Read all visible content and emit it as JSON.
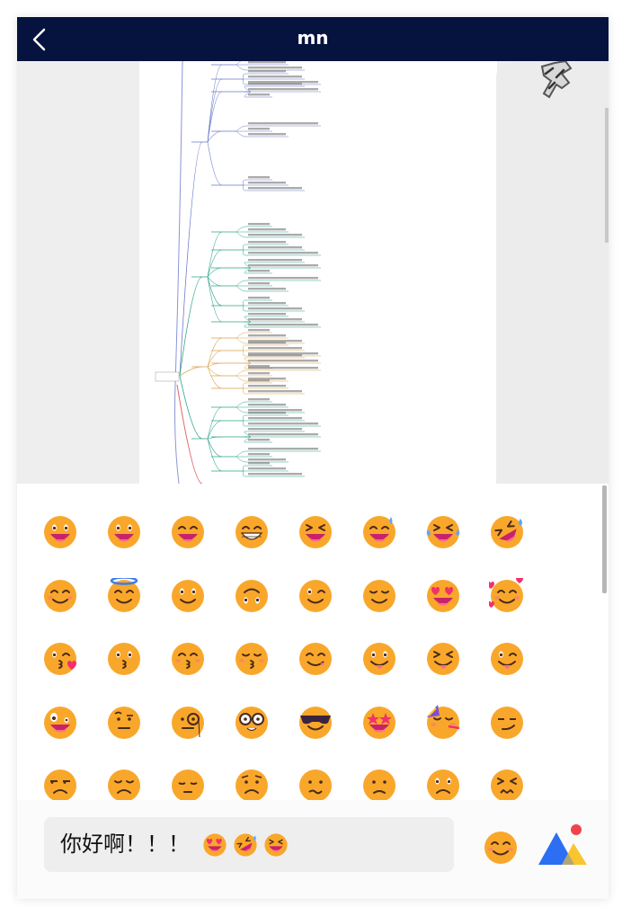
{
  "header": {
    "title": "mn",
    "back_icon": "chevron-left-icon"
  },
  "colors": {
    "header_bg": "#05133e",
    "emoji_face": "#f9a72b",
    "mouth": "#c9226d",
    "accent_red": "#f0424f"
  },
  "chat": {
    "image_message": {
      "icon": "mind-map-image"
    },
    "sticker": {
      "icon": "sticker-image"
    }
  },
  "emoji_picker": {
    "rows": [
      [
        "grinning",
        "grinning-big-eyes",
        "grinning-smiling-eyes",
        "beaming",
        "squinting-laugh",
        "grinning-sweat",
        "tears-of-joy",
        "rolling-laughing"
      ],
      [
        "smiling-blush",
        "halo",
        "slightly-smiling",
        "upside-down",
        "winking",
        "relieved",
        "heart-eyes",
        "smiling-hearts"
      ],
      [
        "kissing-heart",
        "kissing",
        "kissing-relaxed",
        "kissing-closed-eyes",
        "yum",
        "tongue-out",
        "squinting-tongue",
        "winking-tongue"
      ],
      [
        "zany",
        "raised-eyebrow",
        "monocle",
        "nerd",
        "sunglasses",
        "star-struck",
        "partying",
        "smirking"
      ],
      [
        "unamused",
        "disappointed",
        "pensive",
        "worried",
        "confused",
        "slightly-frowning",
        "frowning",
        "persevering"
      ]
    ]
  },
  "input": {
    "text": "你好啊！！！",
    "inline_emojis": [
      "heart-eyes",
      "rolling-laughing",
      "squinting-laugh"
    ],
    "emoji_button_icon": "smiling-face-icon",
    "image_button_icon": "image-upload-icon"
  }
}
